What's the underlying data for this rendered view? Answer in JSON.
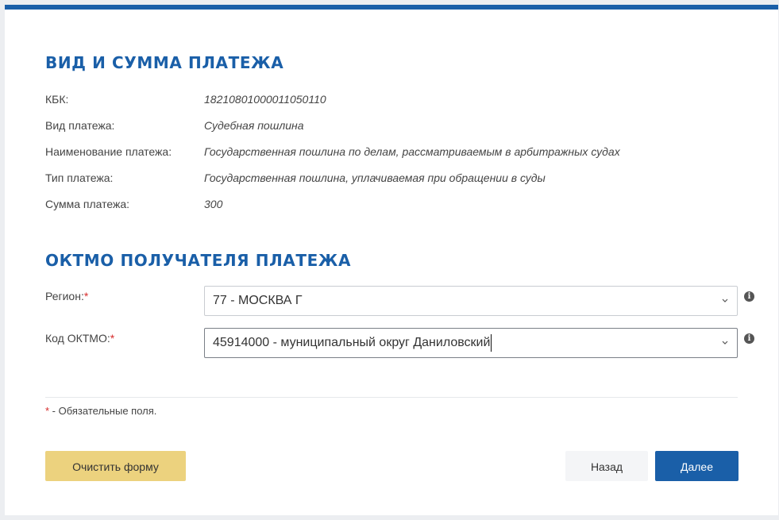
{
  "payment": {
    "title": "ВИД И СУММА ПЛАТЕЖА",
    "rows": [
      {
        "label": "КБК:",
        "value": "18210801000011050110"
      },
      {
        "label": "Вид платежа:",
        "value": "Судебная пошлина"
      },
      {
        "label": "Наименование платежа:",
        "value": "Государственная пошлина по делам, рассматриваемым в арбитражных судах"
      },
      {
        "label": "Тип платежа:",
        "value": "Государственная пошлина, уплачиваемая при обращении в суды"
      },
      {
        "label": "Сумма платежа:",
        "value": "300"
      }
    ]
  },
  "oktmo": {
    "title": "ОКТМО ПОЛУЧАТЕЛЯ ПЛАТЕЖА",
    "region": {
      "label": "Регион:",
      "required_mark": "*",
      "value": "77 - МОСКВА Г"
    },
    "code": {
      "label": "Код ОКТМО:",
      "required_mark": "*",
      "value": "45914000 - муниципальный округ Даниловский"
    }
  },
  "footer_note": {
    "mark": "*",
    "text": " - Обязательные поля."
  },
  "buttons": {
    "clear": "Очистить форму",
    "back": "Назад",
    "next": "Далее"
  },
  "icons": {
    "info": "info-icon",
    "dropdown": "chevron-down-icon"
  },
  "colors": {
    "accent": "#1a5fa8",
    "clear_button": "#ecd27e",
    "required": "#d62b2b"
  }
}
